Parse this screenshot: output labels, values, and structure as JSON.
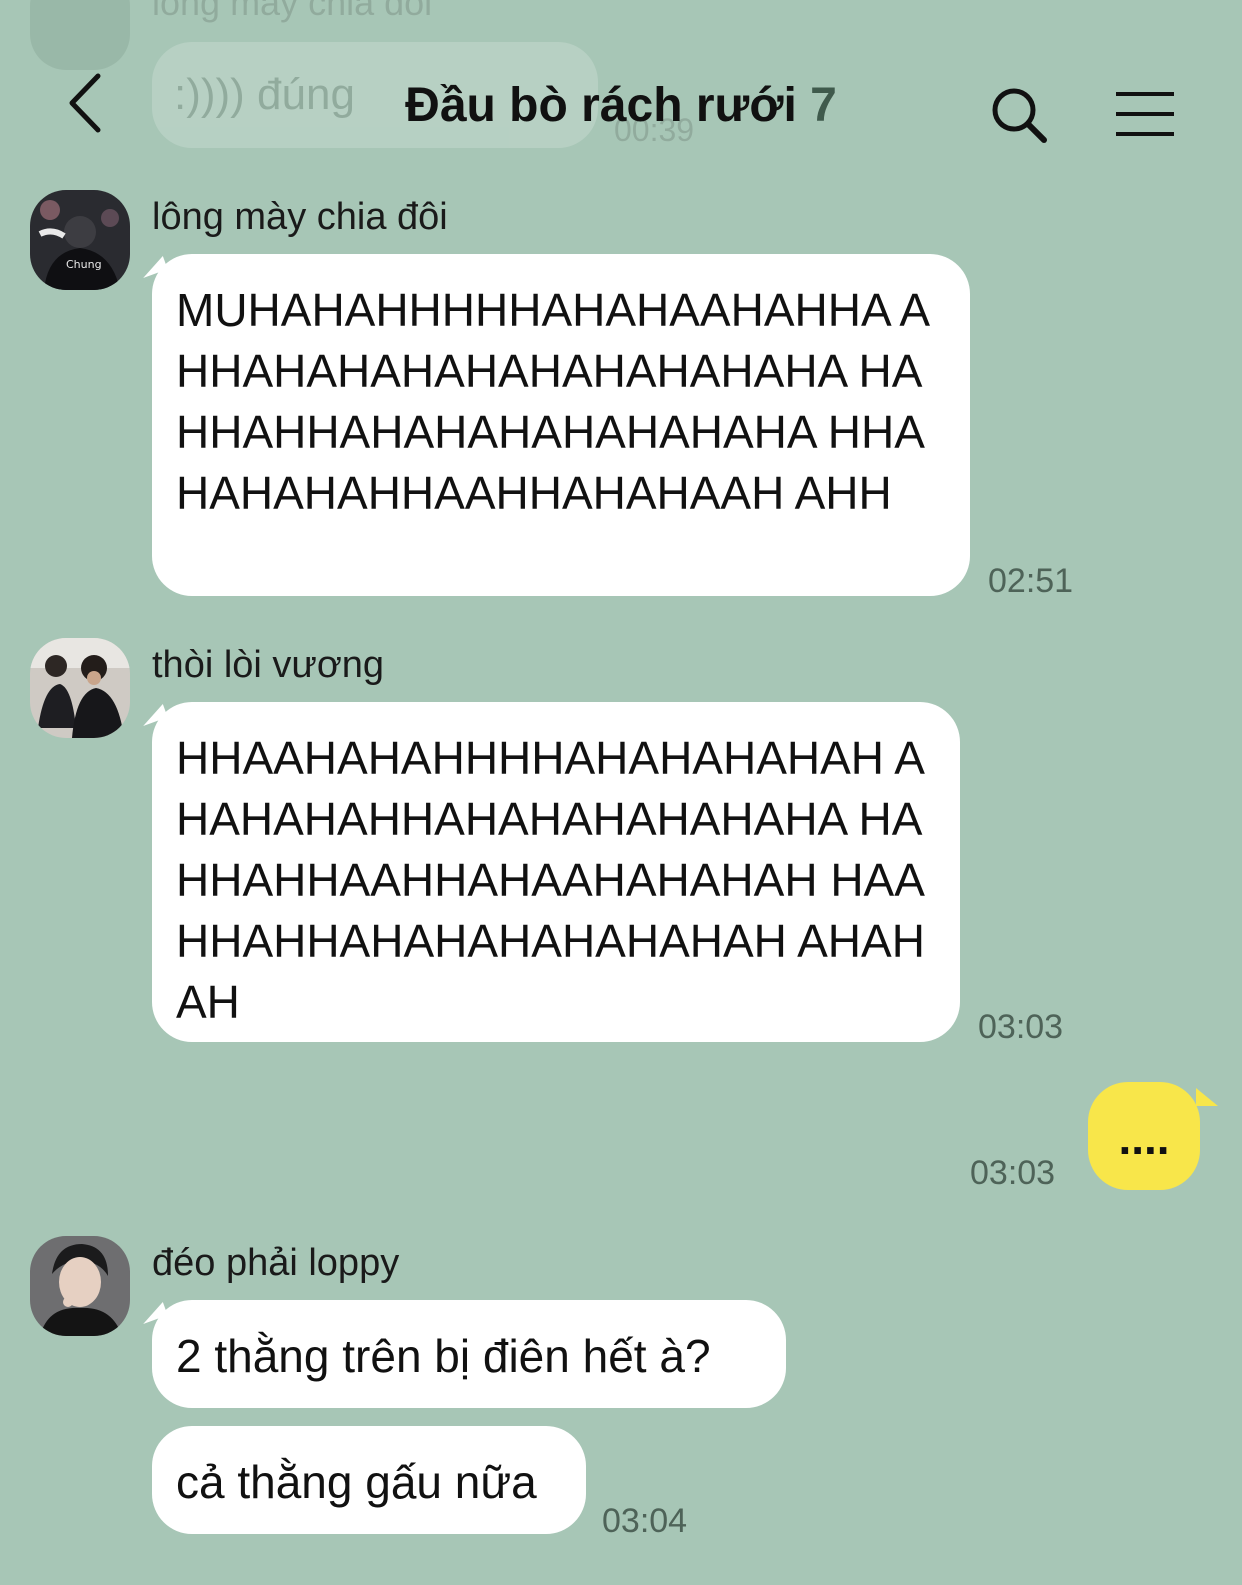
{
  "ghost": {
    "sender": "lông mày chia đôi",
    "text": ":)))) đúng",
    "time": "00:39"
  },
  "header": {
    "title": "Đầu bò rách rưới",
    "member_count": "7",
    "icons": [
      "back-arrow-icon",
      "search-icon",
      "menu-icon"
    ]
  },
  "messages": [
    {
      "sender": "lông mày chia đôi",
      "text": "MUHAHAHHHHHAHAHAAHAHHA AHHAHAHAHAHAHAHAHAHAHA HAHHAHHAHAHAHAHAHAHAHA HHAHAHAHAHHAAHHAHAHAAH AHH",
      "time": "02:51"
    },
    {
      "sender": "thòi lòi vương",
      "text": "HHAAHAHAHHHHAHAHAHAHAH AHAHAHAHHAHAHAHAHAHAHA HAHHAHHAAHHAHAAHAHAHAH HAAHHAHHAHAHAHAHAHAHAH AHAHAH",
      "time": "03:03"
    },
    {
      "sender": "me",
      "text": "....",
      "time": "03:03"
    },
    {
      "sender": "đéo phải loppy",
      "text": "2 thằng trên bị điên hết à?",
      "text2": "cả thằng gấu nữa",
      "time": "03:04"
    }
  ],
  "colors": {
    "background": "#a7c6b6",
    "bubble_other": "#ffffff",
    "bubble_mine": "#f8e64a",
    "time_text": "#4e6358"
  }
}
